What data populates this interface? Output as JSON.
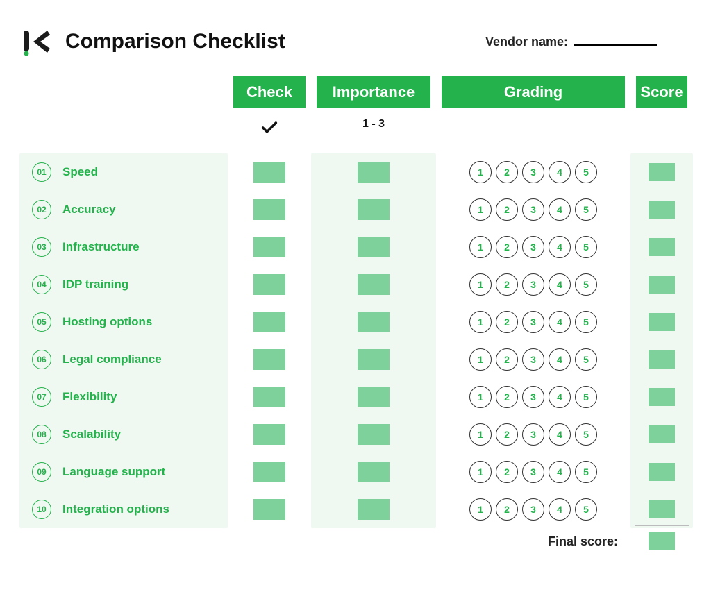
{
  "title": "Comparison Checklist",
  "vendor_label": "Vendor name:",
  "headers": {
    "check": "Check",
    "importance": "Importance",
    "grading": "Grading",
    "score": "Score"
  },
  "sub": {
    "importance": "1 - 3"
  },
  "rows": [
    {
      "num": "01",
      "label": "Speed"
    },
    {
      "num": "02",
      "label": "Accuracy"
    },
    {
      "num": "03",
      "label": "Infrastructure"
    },
    {
      "num": "04",
      "label": "IDP training"
    },
    {
      "num": "05",
      "label": "Hosting options"
    },
    {
      "num": "06",
      "label": "Legal compliance"
    },
    {
      "num": "07",
      "label": "Flexibility"
    },
    {
      "num": "08",
      "label": "Scalability"
    },
    {
      "num": "09",
      "label": "Language support"
    },
    {
      "num": "10",
      "label": "Integration options"
    }
  ],
  "grading_options": [
    "1",
    "2",
    "3",
    "4",
    "5"
  ],
  "final_label": "Final score:"
}
